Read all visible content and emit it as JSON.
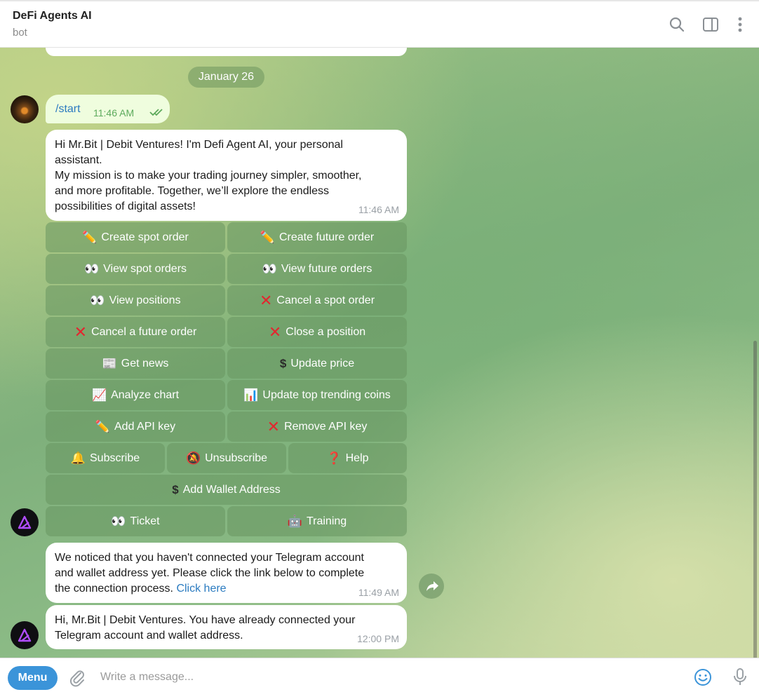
{
  "header": {
    "title": "DeFi Agents AI",
    "subtitle": "bot"
  },
  "chat": {
    "date": "January 26",
    "outgoing": {
      "text": "/start",
      "time": "11:46 AM"
    },
    "welcome": {
      "lines": [
        "Hi Mr.Bit | Debit Ventures! I'm Defi Agent AI, your personal",
        "assistant.",
        "My mission is to make your trading journey simpler, smoother,",
        "and more profitable. Together, we’ll explore the endless",
        "possibilities of digital assets!"
      ],
      "time": "11:46 AM"
    },
    "keyboard": {
      "create_spot": "Create spot order",
      "create_future": "Create future order",
      "view_spot": "View spot orders",
      "view_future": "View future orders",
      "view_positions": "View positions",
      "cancel_spot": "Cancel a spot order",
      "cancel_future": "Cancel a future order",
      "close_position": "Close a position",
      "get_news": "Get news",
      "update_price": "Update price",
      "analyze_chart": "Analyze chart",
      "update_trending": "Update top trending coins",
      "add_api": "Add API key",
      "remove_api": "Remove API key",
      "subscribe": "Subscribe",
      "unsubscribe": "Unsubscribe",
      "help": "Help",
      "add_wallet": "Add Wallet Address",
      "ticket": "Ticket",
      "training": "Training"
    },
    "notice": {
      "lines": [
        "We noticed that you haven't connected your Telegram account",
        "and wallet address yet. Please click the link below to complete",
        "the connection process. "
      ],
      "link": "Click here",
      "time": "11:49 AM"
    },
    "connected": {
      "lines": [
        "Hi, Mr.Bit | Debit Ventures. You have already connected your",
        "Telegram account and wallet address."
      ],
      "time": "12:00 PM"
    }
  },
  "composer": {
    "menu_label": "Menu",
    "placeholder": "Write a message..."
  }
}
